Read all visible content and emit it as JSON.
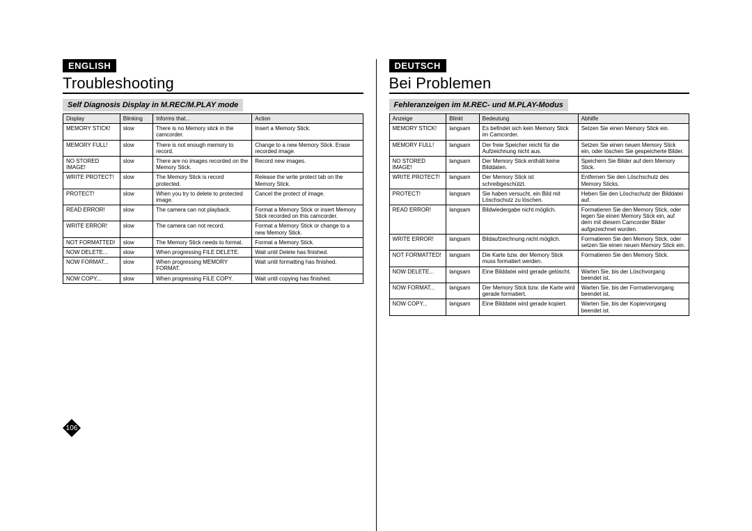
{
  "left": {
    "lang": "ENGLISH",
    "title": "Troubleshooting",
    "subtitle": "Self Diagnosis Display in M.REC/M.PLAY mode",
    "headers": [
      "Display",
      "Blinking",
      "Informs that...",
      "Action"
    ],
    "rows": [
      [
        "MEMORY STICK!",
        "slow",
        "There is no Memory stick in the camcorder.",
        "Insert a Memory Stick."
      ],
      [
        "MEMORY FULL!",
        "slow",
        "There is not enough memory to record.",
        "Change to a new Memory Stick. Erase recorded image."
      ],
      [
        "NO STORED IMAGE!",
        "slow",
        "There are no images recorded on the Memory Stick.",
        "Record new images."
      ],
      [
        "WRITE PROTECT!",
        "slow",
        "The Memory Stick is record protected.",
        "Release the write protect tab on the Memory Stick."
      ],
      [
        "PROTECT!",
        "slow",
        "When you try to delete to protected image.",
        "Cancel the protect of image."
      ],
      [
        "READ ERROR!",
        "slow",
        "The camera can not playback.",
        "Format a Memory Stick or insert Memory Stick recorded on this camcorder."
      ],
      [
        "WRITE ERROR!",
        "slow",
        "The camera can not record.",
        "Format a Memory Stick or change to a new Memory Stick."
      ],
      [
        "NOT FORMATTED!",
        "slow",
        "The Memory Stick needs to format.",
        "Format a Memory Stick."
      ],
      [
        "NOW DELETE...",
        "slow",
        "When progressing FILE DELETE.",
        "Wait until Delete has finished."
      ],
      [
        "NOW FORMAT...",
        "slow",
        "When progressing MEMORY FORMAT.",
        "Wait until formatting has finished."
      ],
      [
        "NOW COPY...",
        "slow",
        "When progressing FILE COPY.",
        "Wait until copying has finished."
      ]
    ]
  },
  "right": {
    "lang": "DEUTSCH",
    "title": "Bei Problemen",
    "subtitle": "Fehleranzeigen im M.REC- und M.PLAY-Modus",
    "headers": [
      "Anzeige",
      "Blinkt",
      "Bedeutung",
      "Abhilfe"
    ],
    "rows": [
      [
        "MEMORY STICK!",
        "langsam",
        "Es befindet sich kein Memory Stick im Camcorder.",
        "Setzen Sie einen Memory Stick ein."
      ],
      [
        "MEMORY FULL!",
        "langsam",
        "Der freie Speicher reicht für die Aufzeichnung nicht aus.",
        "Setzen Sie einen neuen Memory Stick ein, oder löschen Sie gespeicherte Bilder."
      ],
      [
        "NO STORED IMAGE!",
        "langsam",
        "Der Memory Stick enthält keine Bilddaten.",
        "Speichern Sie Bilder auf dem Memory Stick."
      ],
      [
        "WRITE PROTECT!",
        "langsam",
        "Der Memory Stick ist schreibgeschützt.",
        "Entfernen Sie den Löschschutz des Memory Sticks."
      ],
      [
        "PROTECT!",
        "langsam",
        "Sie haben versucht, ein Bild mit Löschschutz zu löschen.",
        "Heben Sie den Löschschutz der Bilddatei auf."
      ],
      [
        "READ ERROR!",
        "langsam",
        "Bildwiedergabe nicht möglich.",
        "Formatieren Sie den Memory Stick, oder legen Sie einen Memory Stick ein, auf dem mit diesem Camcorder Bilder aufgezeichnet wurden."
      ],
      [
        "WRITE ERROR!",
        "langsam",
        "Bildaufzeichnung nicht möglich.",
        "Formatieren Sie den Memory Stick, oder setzen Sie einen neuen Memory Stick ein."
      ],
      [
        "NOT FORMATTED!",
        "langsam",
        "Die Karte bzw. der Memory Stick muss formatiert werden.",
        "Formatieren Sie den Memory Stick."
      ],
      [
        "NOW DELETE...",
        "langsam",
        "Eine Bilddatei wird gerade gelöscht.",
        "Warten Sie, bis der Löschvorgang beendet ist."
      ],
      [
        "NOW FORMAT...",
        "langsam",
        "Der Memory Stick bzw. die Karte wird gerade formatiert.",
        "Warten Sie, bis der Formatiervorgang beendet ist."
      ],
      [
        "NOW COPY...",
        "langsam",
        "Eine Bilddatei wird gerade kopiert.",
        "Warten Sie, bis der Kopiervorgang beendet ist."
      ]
    ]
  },
  "pageNumber": "106"
}
